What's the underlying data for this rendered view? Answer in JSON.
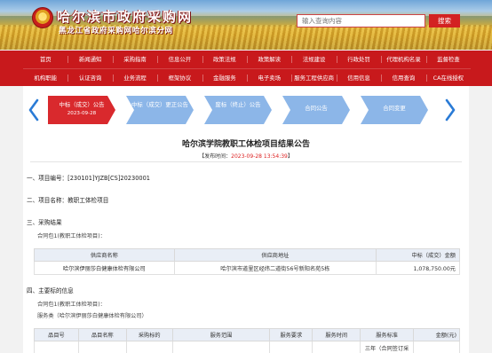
{
  "header": {
    "title": "哈尔滨市政府采购网",
    "subtitle": "黑龙江省政府采购网哈尔滨分网",
    "emblem_text": "★",
    "search_placeholder": "输入查询内容",
    "search_button": "搜索"
  },
  "nav": {
    "row1": [
      "首页",
      "新闻通知",
      "采购指南",
      "信息公开",
      "政策法规",
      "政策解读",
      "法规建设",
      "行政处罚",
      "代理机构名录",
      "监督检查"
    ],
    "row2": [
      "机构职能",
      "认证咨询",
      "业务流程",
      "框架协议",
      "金融服务",
      "电子卖场",
      "服务工程供应商",
      "信用信息",
      "信用查询",
      "CA在线授权"
    ]
  },
  "steps": [
    {
      "label": "中标（成交）公告",
      "date": "2023-09-28"
    },
    {
      "label": "中标（成交）更正公告",
      "date": ""
    },
    {
      "label": "废标（终止）公告",
      "date": ""
    },
    {
      "label": "合同公告",
      "date": ""
    },
    {
      "label": "合同变更",
      "date": ""
    }
  ],
  "article": {
    "title": "哈尔滨学院教职工体检项目结果公告",
    "meta_label": "【发布时间：",
    "meta_time": "2023-09-28 13:54:39",
    "meta_end": "】",
    "sec1_label": "一、项目编号：",
    "sec1_value": "[230101]YJZB[CS]20230001",
    "sec2_label": "二、项目名称：",
    "sec2_value": "教职工体检项目",
    "sec3": "三、采购结果",
    "sec3_sub": "合同包1(教职工体检项目)：",
    "table1_headers": [
      "供应商名称",
      "供应商地址",
      "中标（成交）金额"
    ],
    "table1_row": [
      "哈尔滨伊丽莎白健康体检有限公司",
      "哈尔滨市道里区经纬二道街56号新阳名苑5栋",
      "1,078,750.00元"
    ],
    "sec4": "四、主要标的信息",
    "sec4_sub1": "合同包1(教职工体检项目)：",
    "sec4_sub2": "服务类（哈尔滨伊丽莎白健康体检有限公司）",
    "table2_headers": [
      "品目号",
      "品目名称",
      "采购标的",
      "服务范围",
      "服务要求",
      "服务时间",
      "服务标准",
      "金额(元)"
    ],
    "table2_row": [
      "",
      "",
      "",
      "",
      "",
      "",
      "三年（合同签订采",
      ""
    ]
  }
}
